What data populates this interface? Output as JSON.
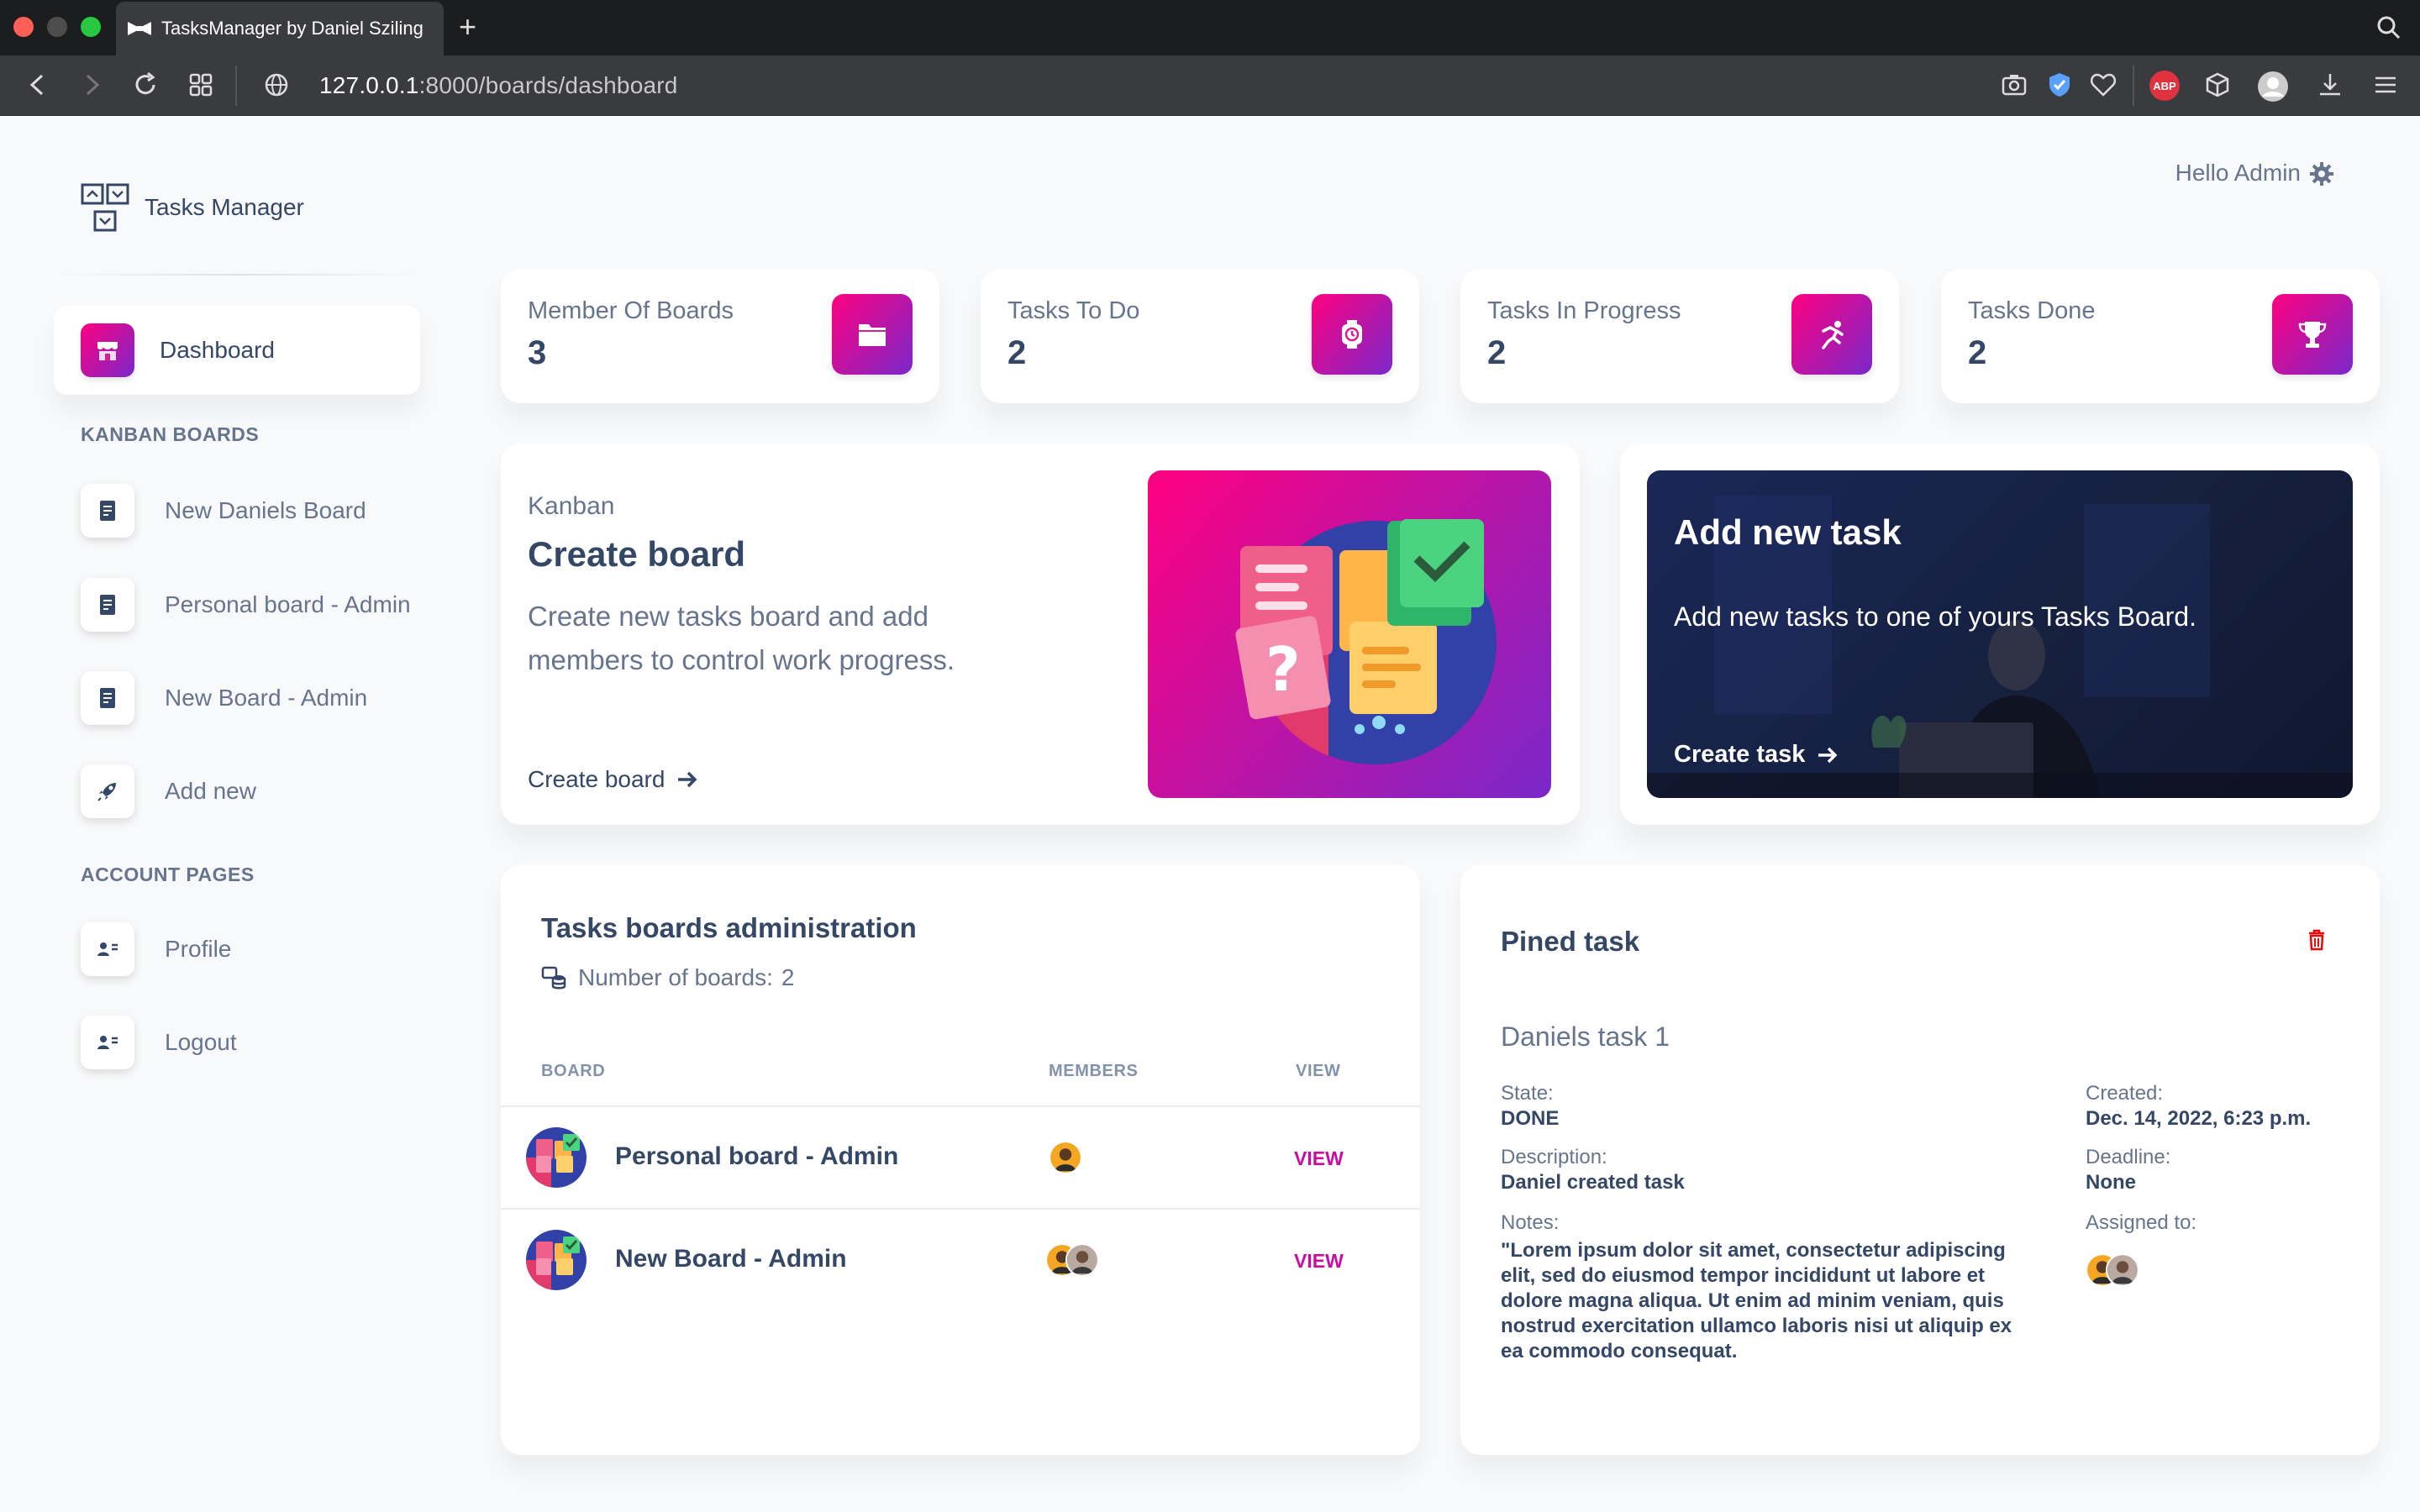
{
  "browser": {
    "tab_title": "TasksManager by Daniel Sziling",
    "url_host": "127.0.0.1",
    "url_path": ":8000/boards/dashboard",
    "abp_label": "ABP"
  },
  "sidebar": {
    "brand": "Tasks Manager",
    "dashboard_label": "Dashboard",
    "kanban_heading": "KANBAN BOARDS",
    "boards": [
      {
        "label": "New Daniels Board"
      },
      {
        "label": "Personal board - Admin"
      },
      {
        "label": "New Board - Admin"
      }
    ],
    "add_new_label": "Add new",
    "account_heading": "ACCOUNT PAGES",
    "profile_label": "Profile",
    "logout_label": "Logout"
  },
  "header": {
    "greeting": "Hello Admin"
  },
  "stats": [
    {
      "label": "Member Of Boards",
      "value": "3",
      "icon": "folder-icon"
    },
    {
      "label": "Tasks To Do",
      "value": "2",
      "icon": "watch-icon"
    },
    {
      "label": "Tasks In Progress",
      "value": "2",
      "icon": "runner-icon"
    },
    {
      "label": "Tasks Done",
      "value": "2",
      "icon": "trophy-icon"
    }
  ],
  "kanban_card": {
    "label": "Kanban",
    "title": "Create board",
    "description": "Create new tasks board and add members to control work progress.",
    "link": "Create board"
  },
  "task_card": {
    "title": "Add new task",
    "description": "Add new tasks to one of yours Tasks Board.",
    "link": "Create task"
  },
  "boards_table": {
    "title": "Tasks boards administration",
    "count_label": "Number of boards:",
    "count_value": "2",
    "headers": {
      "board": "BOARD",
      "members": "MEMBERS",
      "view": "VIEW"
    },
    "rows": [
      {
        "name": "Personal board - Admin",
        "members": 1,
        "view": "VIEW"
      },
      {
        "name": "New Board - Admin",
        "members": 2,
        "view": "VIEW"
      }
    ]
  },
  "pinned": {
    "title": "Pined task",
    "task_name": "Daniels task 1",
    "state_label": "State:",
    "state_value": "DONE",
    "description_label": "Description:",
    "description_value": "Daniel created task",
    "notes_label": "Notes:",
    "notes_value": "\"Lorem ipsum dolor sit amet, consectetur adipiscing elit, sed do eiusmod tempor incididunt ut labore et dolore magna aliqua. Ut enim ad minim veniam, quis nostrud exercitation ullamco laboris nisi ut aliquip ex ea commodo consequat.",
    "created_label": "Created:",
    "created_value": "Dec. 14, 2022, 6:23 p.m.",
    "deadline_label": "Deadline:",
    "deadline_value": "None",
    "assigned_label": "Assigned to:"
  },
  "colors": {
    "accent_gradient_start": "#7928ca",
    "accent_gradient_end": "#ff0080",
    "text_primary": "#344767",
    "text_secondary": "#67748e",
    "view_link": "#cb0c9f",
    "delete": "#ea0606"
  }
}
